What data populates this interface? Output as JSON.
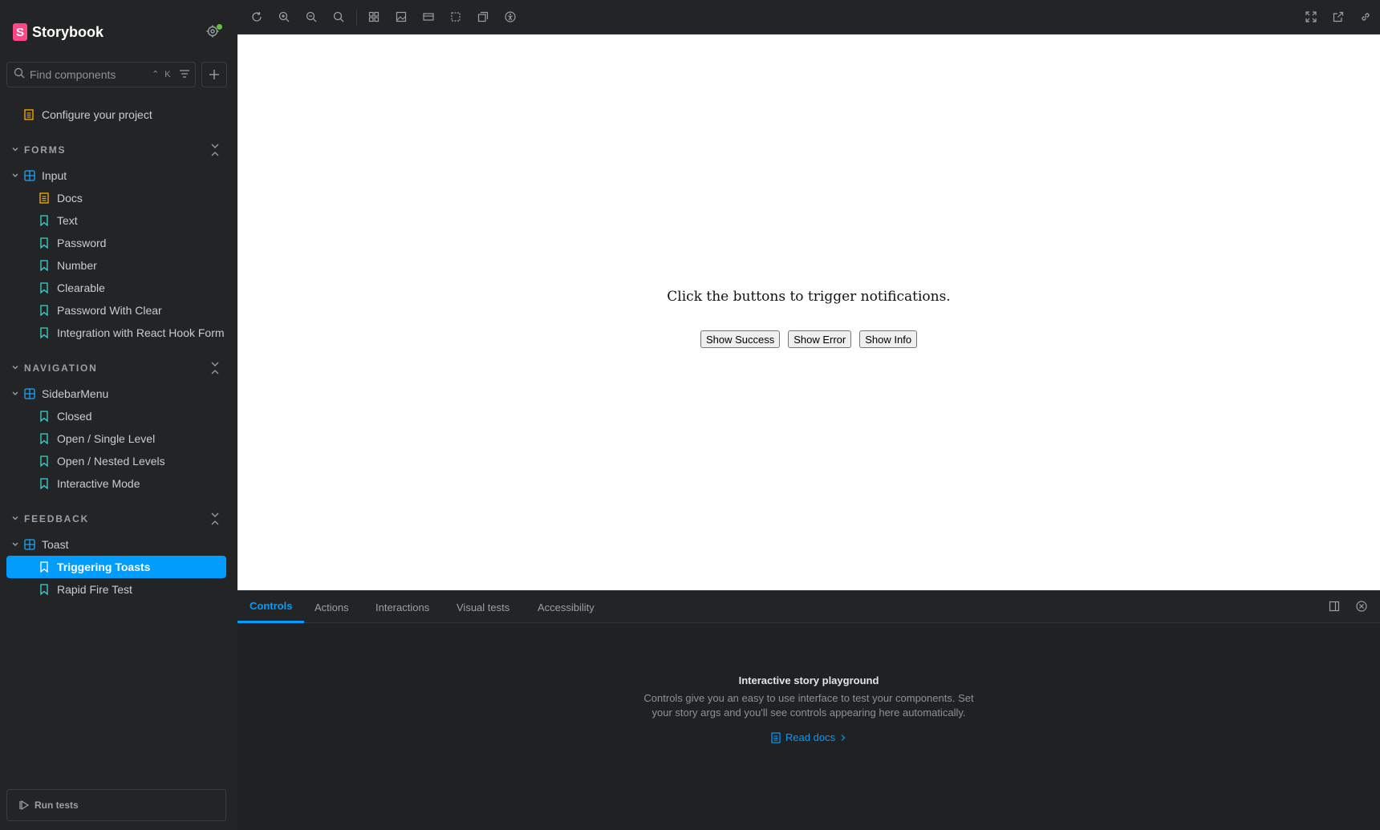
{
  "app": {
    "name": "Storybook",
    "logo_letter": "S"
  },
  "search": {
    "placeholder": "Find components",
    "shortcut": "⌃ K"
  },
  "sidebar": {
    "top_item": "Configure your project",
    "groups": [
      {
        "title": "FORMS",
        "component": "Input",
        "children": [
          "Docs",
          "Text",
          "Password",
          "Number",
          "Clearable",
          "Password With Clear",
          "Integration with React Hook Form"
        ]
      },
      {
        "title": "NAVIGATION",
        "component": "SidebarMenu",
        "children": [
          "Closed",
          "Open / Single Level",
          "Open / Nested Levels",
          "Interactive Mode"
        ]
      },
      {
        "title": "FEEDBACK",
        "component": "Toast",
        "children": [
          "Triggering Toasts",
          "Rapid Fire Test"
        ]
      }
    ],
    "selected": "Triggering Toasts",
    "run_tests": "Run tests"
  },
  "toolbar": {
    "left_icons": [
      "reload-icon",
      "zoom-in-icon",
      "zoom-out-icon",
      "zoom-reset-icon",
      "grid-icon",
      "background-icon",
      "viewport-icon",
      "outline-icon",
      "measure-icon",
      "accessibility-icon"
    ],
    "right_icons": [
      "fullscreen-icon",
      "open-new-tab-icon",
      "copy-link-icon"
    ]
  },
  "preview": {
    "message": "Click the buttons to trigger notifications.",
    "buttons": [
      "Show Success",
      "Show Error",
      "Show Info"
    ]
  },
  "panel": {
    "tabs": [
      "Controls",
      "Actions",
      "Interactions",
      "Visual tests",
      "Accessibility"
    ],
    "active_tab": "Controls",
    "empty_title": "Interactive story playground",
    "empty_desc": "Controls give you an easy to use interface to test your components. Set your story args and you'll see controls appearing here automatically.",
    "read_docs": "Read docs"
  },
  "colors": {
    "accent": "#029cfd",
    "brand": "#ff4785",
    "docs": "#ffae00",
    "component": "#1ea7fd",
    "story": "#37d5d3"
  }
}
